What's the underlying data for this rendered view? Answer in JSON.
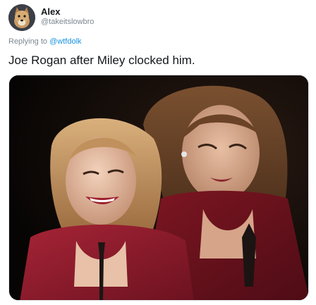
{
  "author": {
    "name": "Alex",
    "handle": "@takeitslowbro",
    "avatar_icon": "dog-avatar-icon"
  },
  "reply": {
    "prefix": "Replying to",
    "mention": "@wtfdolk"
  },
  "tweet": {
    "text": "Joe Rogan after Miley clocked him."
  },
  "media": {
    "type": "photo",
    "icon": "photo-image"
  },
  "colors": {
    "text": "#14171a",
    "secondary": "#7c8790",
    "link": "#1b95e0",
    "photo_background": "#0a0706",
    "dress": "#8e1b2a"
  }
}
